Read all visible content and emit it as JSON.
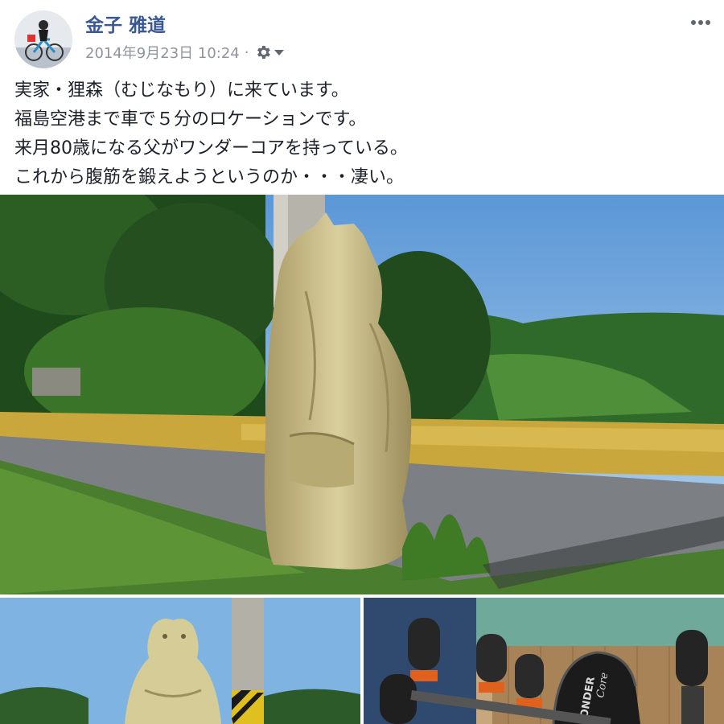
{
  "post": {
    "author": "金子 雅道",
    "timestamp": "2014年9月23日 10:24",
    "separator": "·",
    "privacy_icon": "gear-icon",
    "dropdown_icon": "caret-down-icon",
    "more_icon": "more-vertical-icon",
    "text_lines": [
      "実家・狸森（むじなもり）に来ています。",
      "福島空港まで車で５分のロケーションです。",
      "来月80歳になる父がワンダーコアを持っている。",
      "これから腹筋を鍛えようというのか・・・凄い。"
    ]
  },
  "photos": {
    "sub2_logo_line1": "ONDER",
    "sub2_logo_line2": "Core"
  },
  "colors": {
    "author_link": "#385898",
    "meta_text": "#90949c",
    "body_text": "#1d2129",
    "sky": "#6fa6d8",
    "rice_field": "#c9a73c",
    "statue": "#cbbf8a",
    "grip_orange": "#e0601e"
  }
}
